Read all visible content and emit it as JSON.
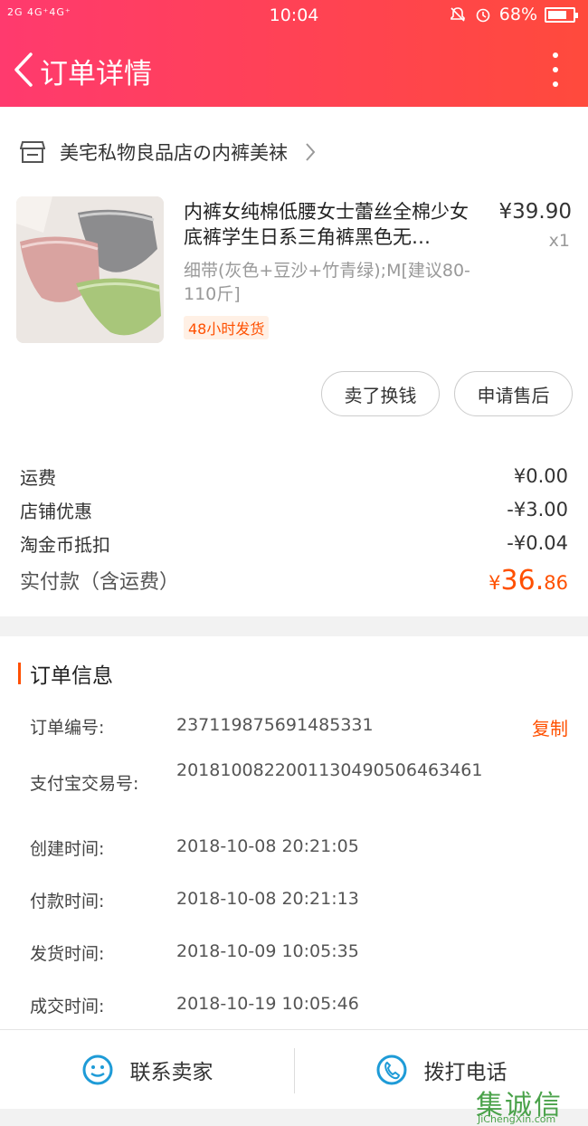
{
  "status_bar": {
    "signal": "2G 4G⁺4G⁺",
    "time": "10:04",
    "battery": "68%"
  },
  "header": {
    "title": "订单详情"
  },
  "shop": {
    "name": "美宅私物良品店の内裤美袜"
  },
  "product": {
    "title": "内裤女纯棉低腰女士蕾丝全棉少女底裤学生日系三角裤黑色无…",
    "price": "¥39.90",
    "qty": "x1",
    "sku": "细带(灰色+豆沙+竹青绿);M[建议80-110斤]",
    "tag": "48小时发货"
  },
  "actions": {
    "sell": "卖了换钱",
    "after_sale": "申请售后"
  },
  "fees": {
    "shipping_label": "运费",
    "shipping": "¥0.00",
    "shop_discount_label": "店铺优惠",
    "shop_discount": "-¥3.00",
    "coin_label": "淘金币抵扣",
    "coin": "-¥0.04",
    "total_label": "实付款（含运费）",
    "total_symbol": "¥",
    "total_int": "36.",
    "total_dec": "86"
  },
  "order_info": {
    "title": "订单信息",
    "copy_label": "复制",
    "rows": [
      {
        "label": "订单编号:",
        "value": "237119875691485331"
      },
      {
        "label": "支付宝交易号:",
        "value": "2018100822001130490506463461"
      },
      {
        "label": "创建时间:",
        "value": "2018-10-08 20:21:05"
      },
      {
        "label": "付款时间:",
        "value": "2018-10-08 20:21:13"
      },
      {
        "label": "发货时间:",
        "value": "2018-10-09 10:05:35"
      },
      {
        "label": "成交时间:",
        "value": "2018-10-19 10:05:46"
      }
    ]
  },
  "bottom": {
    "contact_seller": "联系卖家",
    "call": "拨打电话"
  },
  "watermark": {
    "text": "集诚信",
    "url": "JiChengXin.com"
  },
  "colors": {
    "header_start": "#ff3a6e",
    "header_end": "#ff4a3c",
    "accent": "#ff5000",
    "icon_blue": "#1e9bd7"
  }
}
